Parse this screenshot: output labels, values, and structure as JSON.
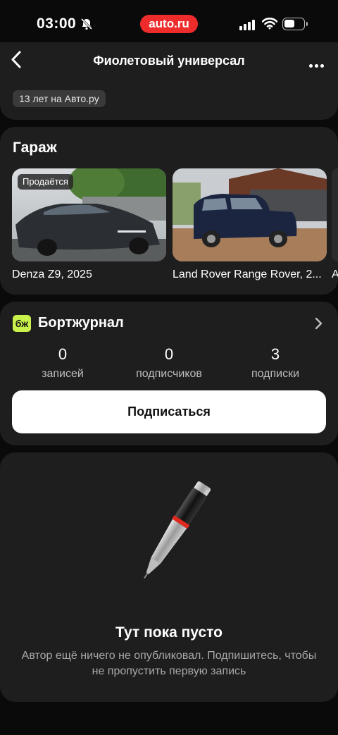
{
  "status_bar": {
    "time": "03:00",
    "center_badge": "auto.ru"
  },
  "nav": {
    "title": "Фиолетовый универсал"
  },
  "profile": {
    "membership_badge": "13 лет на Авто.ру"
  },
  "garage": {
    "title": "Гараж",
    "cars": [
      {
        "name": "Denza Z9, 2025",
        "badge": "Продаётся"
      },
      {
        "name": "Land Rover Range Rover, 2..."
      },
      {
        "name": "A"
      }
    ]
  },
  "bortjournal": {
    "logo": "бж",
    "title": "Бортжурнал",
    "stats": [
      {
        "value": "0",
        "label": "записей"
      },
      {
        "value": "0",
        "label": "подписчиков"
      },
      {
        "value": "3",
        "label": "подписки"
      }
    ],
    "subscribe_label": "Подписаться"
  },
  "empty_state": {
    "title": "Тут пока пусто",
    "text": "Автор ещё ничего не опубликовал. Подпишитесь, чтобы не пропустить первую запись"
  }
}
